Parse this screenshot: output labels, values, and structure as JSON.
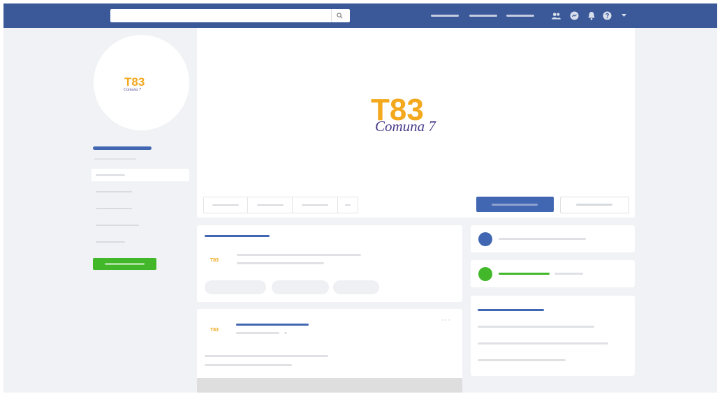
{
  "brand": {
    "logo_text": "T83",
    "logo_script": "Comuna 7",
    "colors": {
      "primary": "#3b5998",
      "accent_blue": "#4267b2",
      "success": "#42b72a",
      "logo_gold": "#f3a81d",
      "logo_purple": "#4a3c8c"
    }
  },
  "icons": {
    "search": "search-icon",
    "friends": "friends-icon",
    "messenger": "messenger-icon",
    "notifications": "bell-icon",
    "help": "help-icon",
    "menu": "chevron-down-icon",
    "more": "more-options-icon"
  },
  "post": {
    "more_label": "···"
  }
}
